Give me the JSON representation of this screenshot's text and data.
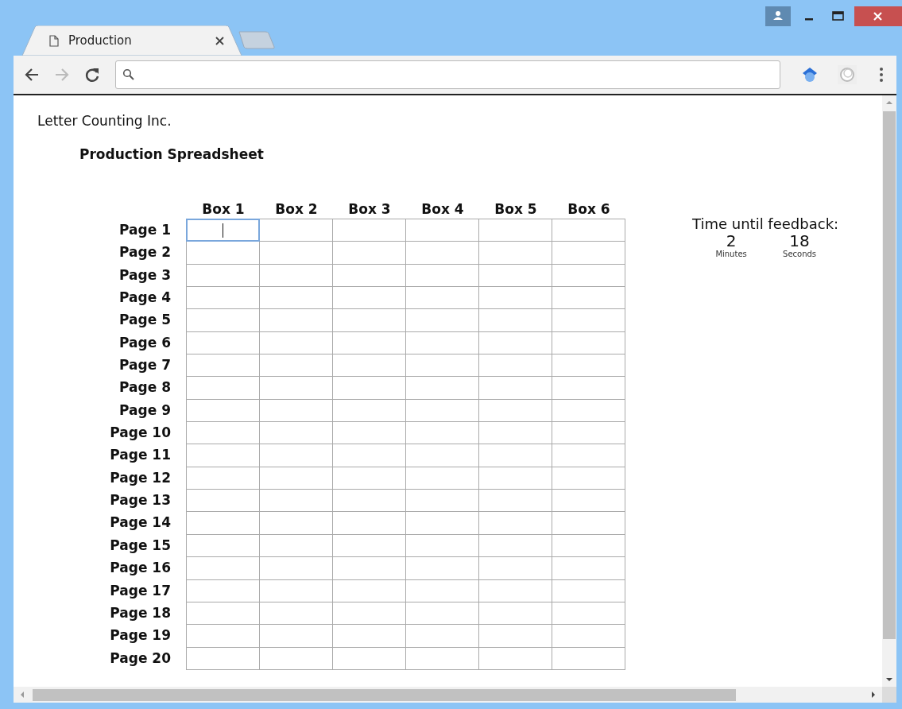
{
  "tab": {
    "title": "Production",
    "selected": true
  },
  "company": "Letter Counting Inc.",
  "title": "Production Spreadsheet",
  "columns": [
    "Box 1",
    "Box 2",
    "Box 3",
    "Box 4",
    "Box 5",
    "Box 6"
  ],
  "rows": [
    {
      "label": "Page 1",
      "cells": [
        {
          "focused": true
        },
        {
          "focused": false
        },
        {
          "focused": false
        },
        {
          "focused": false
        },
        {
          "focused": false
        },
        {
          "focused": false
        }
      ]
    },
    {
      "label": "Page 2",
      "cells": [
        {
          "focused": false
        },
        {
          "focused": false
        },
        {
          "focused": false
        },
        {
          "focused": false
        },
        {
          "focused": false
        },
        {
          "focused": false
        }
      ]
    },
    {
      "label": "Page 3",
      "cells": [
        {
          "focused": false
        },
        {
          "focused": false
        },
        {
          "focused": false
        },
        {
          "focused": false
        },
        {
          "focused": false
        },
        {
          "focused": false
        }
      ]
    },
    {
      "label": "Page 4",
      "cells": [
        {
          "focused": false
        },
        {
          "focused": false
        },
        {
          "focused": false
        },
        {
          "focused": false
        },
        {
          "focused": false
        },
        {
          "focused": false
        }
      ]
    },
    {
      "label": "Page 5",
      "cells": [
        {
          "focused": false
        },
        {
          "focused": false
        },
        {
          "focused": false
        },
        {
          "focused": false
        },
        {
          "focused": false
        },
        {
          "focused": false
        }
      ]
    },
    {
      "label": "Page 6",
      "cells": [
        {
          "focused": false
        },
        {
          "focused": false
        },
        {
          "focused": false
        },
        {
          "focused": false
        },
        {
          "focused": false
        },
        {
          "focused": false
        }
      ]
    },
    {
      "label": "Page 7",
      "cells": [
        {
          "focused": false
        },
        {
          "focused": false
        },
        {
          "focused": false
        },
        {
          "focused": false
        },
        {
          "focused": false
        },
        {
          "focused": false
        }
      ]
    },
    {
      "label": "Page 8",
      "cells": [
        {
          "focused": false
        },
        {
          "focused": false
        },
        {
          "focused": false
        },
        {
          "focused": false
        },
        {
          "focused": false
        },
        {
          "focused": false
        }
      ]
    },
    {
      "label": "Page 9",
      "cells": [
        {
          "focused": false
        },
        {
          "focused": false
        },
        {
          "focused": false
        },
        {
          "focused": false
        },
        {
          "focused": false
        },
        {
          "focused": false
        }
      ]
    },
    {
      "label": "Page 10",
      "cells": [
        {
          "focused": false
        },
        {
          "focused": false
        },
        {
          "focused": false
        },
        {
          "focused": false
        },
        {
          "focused": false
        },
        {
          "focused": false
        }
      ]
    },
    {
      "label": "Page 11",
      "cells": [
        {
          "focused": false
        },
        {
          "focused": false
        },
        {
          "focused": false
        },
        {
          "focused": false
        },
        {
          "focused": false
        },
        {
          "focused": false
        }
      ]
    },
    {
      "label": "Page 12",
      "cells": [
        {
          "focused": false
        },
        {
          "focused": false
        },
        {
          "focused": false
        },
        {
          "focused": false
        },
        {
          "focused": false
        },
        {
          "focused": false
        }
      ]
    },
    {
      "label": "Page 13",
      "cells": [
        {
          "focused": false
        },
        {
          "focused": false
        },
        {
          "focused": false
        },
        {
          "focused": false
        },
        {
          "focused": false
        },
        {
          "focused": false
        }
      ]
    },
    {
      "label": "Page 14",
      "cells": [
        {
          "focused": false
        },
        {
          "focused": false
        },
        {
          "focused": false
        },
        {
          "focused": false
        },
        {
          "focused": false
        },
        {
          "focused": false
        }
      ]
    },
    {
      "label": "Page 15",
      "cells": [
        {
          "focused": false
        },
        {
          "focused": false
        },
        {
          "focused": false
        },
        {
          "focused": false
        },
        {
          "focused": false
        },
        {
          "focused": false
        }
      ]
    },
    {
      "label": "Page 16",
      "cells": [
        {
          "focused": false
        },
        {
          "focused": false
        },
        {
          "focused": false
        },
        {
          "focused": false
        },
        {
          "focused": false
        },
        {
          "focused": false
        }
      ]
    },
    {
      "label": "Page 17",
      "cells": [
        {
          "focused": false
        },
        {
          "focused": false
        },
        {
          "focused": false
        },
        {
          "focused": false
        },
        {
          "focused": false
        },
        {
          "focused": false
        }
      ]
    },
    {
      "label": "Page 18",
      "cells": [
        {
          "focused": false
        },
        {
          "focused": false
        },
        {
          "focused": false
        },
        {
          "focused": false
        },
        {
          "focused": false
        },
        {
          "focused": false
        }
      ]
    },
    {
      "label": "Page 19",
      "cells": [
        {
          "focused": false
        },
        {
          "focused": false
        },
        {
          "focused": false
        },
        {
          "focused": false
        },
        {
          "focused": false
        },
        {
          "focused": false
        }
      ]
    },
    {
      "label": "Page 20",
      "cells": [
        {
          "focused": false
        },
        {
          "focused": false
        },
        {
          "focused": false
        },
        {
          "focused": false
        },
        {
          "focused": false
        },
        {
          "focused": false
        }
      ]
    }
  ],
  "timer": {
    "heading": "Time until feedback:",
    "units": [
      {
        "value": "2",
        "label": "Minutes"
      },
      {
        "value": "18",
        "label": "Seconds"
      }
    ]
  }
}
